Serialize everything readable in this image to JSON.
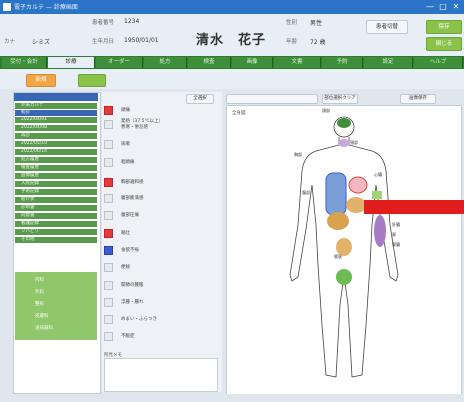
{
  "window": {
    "title": "電子カルテ — 診療画面",
    "controls": [
      "—",
      "□",
      "✕"
    ]
  },
  "header": {
    "fields": [
      {
        "label": "患者番号",
        "value": "1234"
      },
      {
        "label": "カナ",
        "value": "シミズ"
      },
      {
        "label": "性別",
        "value": "男性"
      },
      {
        "label": "生年月日",
        "value": "1950/01/01"
      },
      {
        "label": "年齢",
        "value": "72 歳"
      }
    ],
    "patient_name": "清水　花子",
    "buttons": [
      "患者切替",
      "保存",
      "閉じる"
    ]
  },
  "nav": {
    "tabs": [
      "受付・会計",
      "診療",
      "オーダー",
      "処方",
      "検査",
      "画像",
      "文書",
      "予約",
      "設定",
      "ヘルプ"
    ],
    "active_index": 1
  },
  "subbar": {
    "orange_button": "新規",
    "green_button": ""
  },
  "tree": {
    "items": [
      "外来カルテ",
      "初診",
      "2022/04/01",
      "2022/04/08",
      "再診",
      "2022/05/10",
      "2022/06/14",
      "処方履歴",
      "検査履歴",
      "画像履歴",
      "入院記録",
      "手術記録",
      "紹介状",
      "診断書",
      "同意書",
      "看護記録",
      "リハビリ",
      "その他"
    ],
    "lower_items": [
      "内科",
      "外科",
      "整形",
      "皮膚科",
      "泌尿器科"
    ],
    "selected_index": 1
  },
  "symptoms": {
    "button": "全選択",
    "items": [
      {
        "label": "頭痛",
        "state": "red"
      },
      {
        "label": "発熱（37.5℃以上）\n悪寒・倦怠感",
        "state": "none"
      },
      {
        "label": "咳嗽",
        "state": "none"
      },
      {
        "label": "咽頭痛",
        "state": "none"
      },
      {
        "label": "胸部違和感",
        "state": "red"
      },
      {
        "label": "腹部膨満感",
        "state": "none"
      },
      {
        "label": "腹部圧痛",
        "state": "none"
      },
      {
        "label": "嘔吐",
        "state": "red"
      },
      {
        "label": "食欲不振",
        "state": "blue"
      },
      {
        "label": "便秘",
        "state": "none"
      },
      {
        "label": "関節の腫脹",
        "state": "none"
      },
      {
        "label": "浮腫・腫れ",
        "state": "none"
      },
      {
        "label": "めまい・ふらつき",
        "state": "none"
      },
      {
        "label": "不眠症",
        "state": "none"
      }
    ],
    "memo_label": "所見メモ"
  },
  "body_map": {
    "canvas_label": "全身図",
    "bar_button": "",
    "buttons": [
      "部位選択クリア",
      "画像保存"
    ],
    "labels": [
      "頭部",
      "頸部",
      "胸部",
      "腹部",
      "肝臓",
      "胃",
      "腎臓",
      "膀胱",
      "心臓"
    ]
  },
  "colors": {
    "accent": "#2e7d32",
    "titlebar": "#2b74c7",
    "alert": "#e11d1d"
  }
}
